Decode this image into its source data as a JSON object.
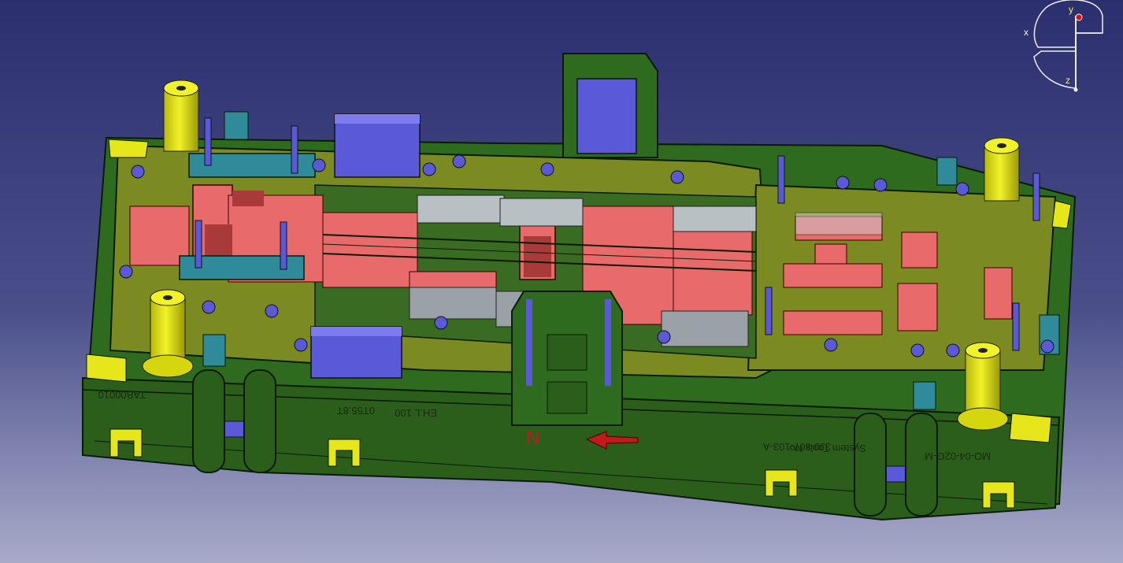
{
  "viewport": {
    "background_top": "#2c2f6e",
    "background_bottom": "#a8aac8"
  },
  "compass": {
    "axis_x": "x",
    "axis_y": "y",
    "axis_z": "z"
  },
  "model": {
    "label_left": "TAB00010",
    "label_weight": "0T55.8T",
    "label_code": "EH.L 100",
    "label_dir": "N",
    "label_part": "3J0-807-103-A",
    "label_maker": "System Tools No",
    "label_right": "MO-04-02G-M"
  },
  "colors": {
    "base_green": "#2f6b1f",
    "plate_olive": "#7c8a22",
    "pink": "#e86a6a",
    "blue": "#5a5ad8",
    "yellow": "#e6e61a",
    "teal": "#2f8a9a",
    "grey": "#b8c0c4"
  }
}
